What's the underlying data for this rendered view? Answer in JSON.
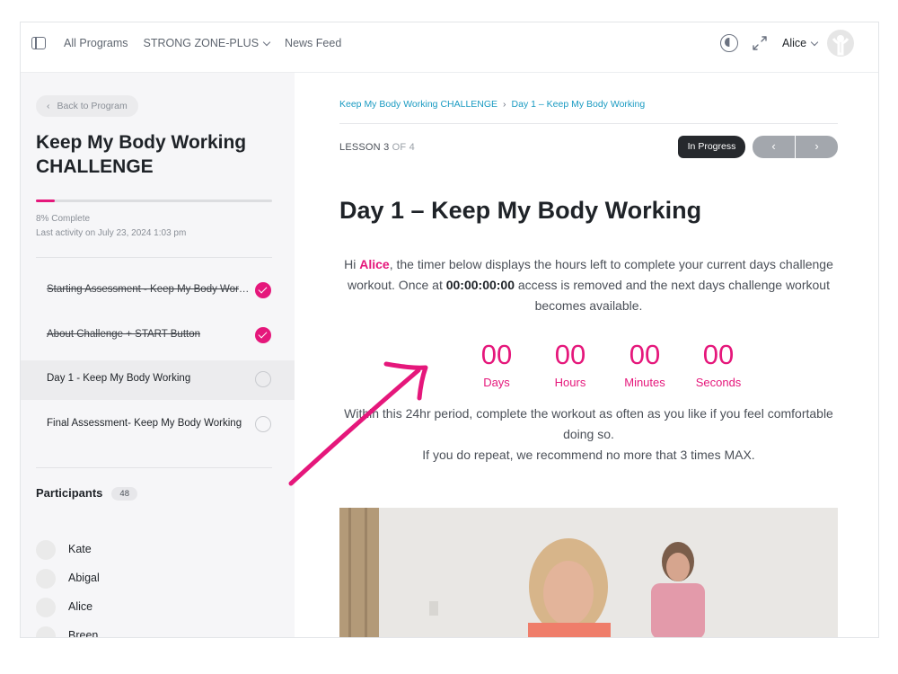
{
  "topbar": {
    "nav": [
      {
        "label": "All Programs",
        "dropdown": false
      },
      {
        "label": "STRONG ZONE-PLUS",
        "dropdown": true
      },
      {
        "label": "News Feed",
        "dropdown": false
      }
    ],
    "user": "Alice"
  },
  "sidebar": {
    "back_label": "Back to Program",
    "course_title": "Keep My Body Working CHALLENGE",
    "progress_fraction": 0.08,
    "percent_complete": "8% Complete",
    "last_activity": "Last activity on July 23, 2024 1:03 pm",
    "lessons": [
      {
        "label": "Starting Assessment - Keep My Body Working",
        "done": true,
        "active": false
      },
      {
        "label": "About Challenge + START Button",
        "done": true,
        "active": false
      },
      {
        "label": "Day 1 - Keep My Body Working",
        "done": false,
        "active": true
      },
      {
        "label": "Final Assessment- Keep My Body Working",
        "done": false,
        "active": false
      }
    ],
    "participants_label": "Participants",
    "participants_count": "48",
    "participants": [
      "Kate",
      "Abigal",
      "Alice",
      "Breen"
    ]
  },
  "main": {
    "breadcrumb": [
      "Keep My Body Working CHALLENGE",
      "Day 1 – Keep My Body Working"
    ],
    "lesson_label": "LESSON 3",
    "lesson_of": "OF 4",
    "status": "In Progress",
    "prev_label": "‹",
    "next_label": "›",
    "title": "Day 1 – Keep My Body Working",
    "intro": {
      "pre": "Hi ",
      "name": "Alice",
      "mid": ", the timer below displays the hours left to complete your current days challenge workout. Once at ",
      "time": "00:00:00:00",
      "post": " access is removed and the next days challenge workout becomes available."
    },
    "timer": [
      {
        "value": "00",
        "label": "Days"
      },
      {
        "value": "00",
        "label": "Hours"
      },
      {
        "value": "00",
        "label": "Minutes"
      },
      {
        "value": "00",
        "label": "Seconds"
      }
    ],
    "outro_line1": "Within this 24hr period, complete the workout as often as you like if you feel comfortable doing so.",
    "outro_line2": "If you do repeat, we recommend no more that 3 times MAX."
  },
  "colors": {
    "accent": "#e5177b",
    "link": "#1b9bc2",
    "sidebar_bg": "#f6f6f8"
  }
}
